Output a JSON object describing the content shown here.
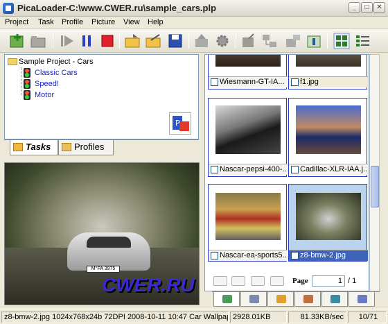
{
  "window": {
    "title": "PicaLoader-C:\\www.CWER.ru\\sample_cars.plp",
    "min_glyph": "_",
    "max_glyph": "□",
    "close_glyph": "✕"
  },
  "menu": [
    "Project",
    "Task",
    "Profile",
    "Picture",
    "View",
    "Help"
  ],
  "toolbar_icons": [
    "new-task-icon",
    "open-folder-icon",
    "play-step-icon",
    "pause-icon",
    "stop-icon",
    "open-project-icon",
    "export-icon",
    "save-icon",
    "upload-icon",
    "settings-gear-icon",
    "download-icon",
    "tree-network-icon",
    "send-icon",
    "info-icon",
    "grid-view-icon",
    "list-view-icon"
  ],
  "project": {
    "root": "Sample Project - Cars",
    "tasks": [
      "Classic Cars",
      "Speed!",
      "Motor"
    ]
  },
  "left_tabs": {
    "tasks": "Tasks",
    "profiles": "Profiles"
  },
  "preview": {
    "plate": "M°PA 3975",
    "watermark": "CWER.RU"
  },
  "thumbnails": [
    {
      "caption": "Wiesmann-GT-IA...",
      "selected": false
    },
    {
      "caption": "f1.jpg",
      "selected": false
    },
    {
      "caption": "Nascar-pepsi-400-...",
      "selected": false
    },
    {
      "caption": "Cadillac-XLR-IAA.j...",
      "selected": false
    },
    {
      "caption": "Nascar-ea-sports5...",
      "selected": false
    },
    {
      "caption": "z8-bmw-2.jpg",
      "selected": true
    }
  ],
  "pager": {
    "label": "Page",
    "current": "1",
    "total": "/ 1"
  },
  "status": {
    "info": "z8-bmw-2.jpg 1024x768x24b 72DPI 2008-10-11 10:47 Car Wallpap",
    "size": "2928.01KB",
    "speed": "81.33KB/sec",
    "count": "10/71"
  },
  "colors": {
    "link": "#1a23c4",
    "selection": "#3d64b8",
    "card_border": "#2a3ad0"
  }
}
